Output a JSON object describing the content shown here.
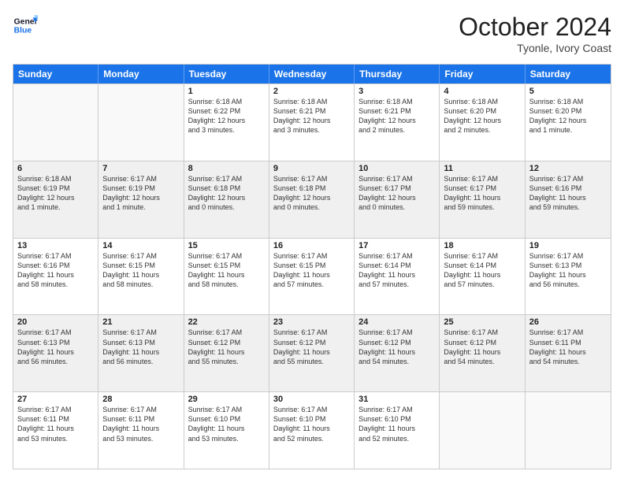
{
  "logo": {
    "line1": "General",
    "line2": "Blue"
  },
  "header": {
    "month": "October 2024",
    "location": "Tyonle, Ivory Coast"
  },
  "weekdays": [
    "Sunday",
    "Monday",
    "Tuesday",
    "Wednesday",
    "Thursday",
    "Friday",
    "Saturday"
  ],
  "rows": [
    [
      {
        "day": "",
        "lines": [],
        "empty": true
      },
      {
        "day": "",
        "lines": [],
        "empty": true
      },
      {
        "day": "1",
        "lines": [
          "Sunrise: 6:18 AM",
          "Sunset: 6:22 PM",
          "Daylight: 12 hours",
          "and 3 minutes."
        ]
      },
      {
        "day": "2",
        "lines": [
          "Sunrise: 6:18 AM",
          "Sunset: 6:21 PM",
          "Daylight: 12 hours",
          "and 3 minutes."
        ]
      },
      {
        "day": "3",
        "lines": [
          "Sunrise: 6:18 AM",
          "Sunset: 6:21 PM",
          "Daylight: 12 hours",
          "and 2 minutes."
        ]
      },
      {
        "day": "4",
        "lines": [
          "Sunrise: 6:18 AM",
          "Sunset: 6:20 PM",
          "Daylight: 12 hours",
          "and 2 minutes."
        ]
      },
      {
        "day": "5",
        "lines": [
          "Sunrise: 6:18 AM",
          "Sunset: 6:20 PM",
          "Daylight: 12 hours",
          "and 1 minute."
        ]
      }
    ],
    [
      {
        "day": "6",
        "lines": [
          "Sunrise: 6:18 AM",
          "Sunset: 6:19 PM",
          "Daylight: 12 hours",
          "and 1 minute."
        ],
        "shaded": true
      },
      {
        "day": "7",
        "lines": [
          "Sunrise: 6:17 AM",
          "Sunset: 6:19 PM",
          "Daylight: 12 hours",
          "and 1 minute."
        ],
        "shaded": true
      },
      {
        "day": "8",
        "lines": [
          "Sunrise: 6:17 AM",
          "Sunset: 6:18 PM",
          "Daylight: 12 hours",
          "and 0 minutes."
        ],
        "shaded": true
      },
      {
        "day": "9",
        "lines": [
          "Sunrise: 6:17 AM",
          "Sunset: 6:18 PM",
          "Daylight: 12 hours",
          "and 0 minutes."
        ],
        "shaded": true
      },
      {
        "day": "10",
        "lines": [
          "Sunrise: 6:17 AM",
          "Sunset: 6:17 PM",
          "Daylight: 12 hours",
          "and 0 minutes."
        ],
        "shaded": true
      },
      {
        "day": "11",
        "lines": [
          "Sunrise: 6:17 AM",
          "Sunset: 6:17 PM",
          "Daylight: 11 hours",
          "and 59 minutes."
        ],
        "shaded": true
      },
      {
        "day": "12",
        "lines": [
          "Sunrise: 6:17 AM",
          "Sunset: 6:16 PM",
          "Daylight: 11 hours",
          "and 59 minutes."
        ],
        "shaded": true
      }
    ],
    [
      {
        "day": "13",
        "lines": [
          "Sunrise: 6:17 AM",
          "Sunset: 6:16 PM",
          "Daylight: 11 hours",
          "and 58 minutes."
        ]
      },
      {
        "day": "14",
        "lines": [
          "Sunrise: 6:17 AM",
          "Sunset: 6:15 PM",
          "Daylight: 11 hours",
          "and 58 minutes."
        ]
      },
      {
        "day": "15",
        "lines": [
          "Sunrise: 6:17 AM",
          "Sunset: 6:15 PM",
          "Daylight: 11 hours",
          "and 58 minutes."
        ]
      },
      {
        "day": "16",
        "lines": [
          "Sunrise: 6:17 AM",
          "Sunset: 6:15 PM",
          "Daylight: 11 hours",
          "and 57 minutes."
        ]
      },
      {
        "day": "17",
        "lines": [
          "Sunrise: 6:17 AM",
          "Sunset: 6:14 PM",
          "Daylight: 11 hours",
          "and 57 minutes."
        ]
      },
      {
        "day": "18",
        "lines": [
          "Sunrise: 6:17 AM",
          "Sunset: 6:14 PM",
          "Daylight: 11 hours",
          "and 57 minutes."
        ]
      },
      {
        "day": "19",
        "lines": [
          "Sunrise: 6:17 AM",
          "Sunset: 6:13 PM",
          "Daylight: 11 hours",
          "and 56 minutes."
        ]
      }
    ],
    [
      {
        "day": "20",
        "lines": [
          "Sunrise: 6:17 AM",
          "Sunset: 6:13 PM",
          "Daylight: 11 hours",
          "and 56 minutes."
        ],
        "shaded": true
      },
      {
        "day": "21",
        "lines": [
          "Sunrise: 6:17 AM",
          "Sunset: 6:13 PM",
          "Daylight: 11 hours",
          "and 56 minutes."
        ],
        "shaded": true
      },
      {
        "day": "22",
        "lines": [
          "Sunrise: 6:17 AM",
          "Sunset: 6:12 PM",
          "Daylight: 11 hours",
          "and 55 minutes."
        ],
        "shaded": true
      },
      {
        "day": "23",
        "lines": [
          "Sunrise: 6:17 AM",
          "Sunset: 6:12 PM",
          "Daylight: 11 hours",
          "and 55 minutes."
        ],
        "shaded": true
      },
      {
        "day": "24",
        "lines": [
          "Sunrise: 6:17 AM",
          "Sunset: 6:12 PM",
          "Daylight: 11 hours",
          "and 54 minutes."
        ],
        "shaded": true
      },
      {
        "day": "25",
        "lines": [
          "Sunrise: 6:17 AM",
          "Sunset: 6:12 PM",
          "Daylight: 11 hours",
          "and 54 minutes."
        ],
        "shaded": true
      },
      {
        "day": "26",
        "lines": [
          "Sunrise: 6:17 AM",
          "Sunset: 6:11 PM",
          "Daylight: 11 hours",
          "and 54 minutes."
        ],
        "shaded": true
      }
    ],
    [
      {
        "day": "27",
        "lines": [
          "Sunrise: 6:17 AM",
          "Sunset: 6:11 PM",
          "Daylight: 11 hours",
          "and 53 minutes."
        ]
      },
      {
        "day": "28",
        "lines": [
          "Sunrise: 6:17 AM",
          "Sunset: 6:11 PM",
          "Daylight: 11 hours",
          "and 53 minutes."
        ]
      },
      {
        "day": "29",
        "lines": [
          "Sunrise: 6:17 AM",
          "Sunset: 6:10 PM",
          "Daylight: 11 hours",
          "and 53 minutes."
        ]
      },
      {
        "day": "30",
        "lines": [
          "Sunrise: 6:17 AM",
          "Sunset: 6:10 PM",
          "Daylight: 11 hours",
          "and 52 minutes."
        ]
      },
      {
        "day": "31",
        "lines": [
          "Sunrise: 6:17 AM",
          "Sunset: 6:10 PM",
          "Daylight: 11 hours",
          "and 52 minutes."
        ]
      },
      {
        "day": "",
        "lines": [],
        "empty": true
      },
      {
        "day": "",
        "lines": [],
        "empty": true
      }
    ]
  ]
}
